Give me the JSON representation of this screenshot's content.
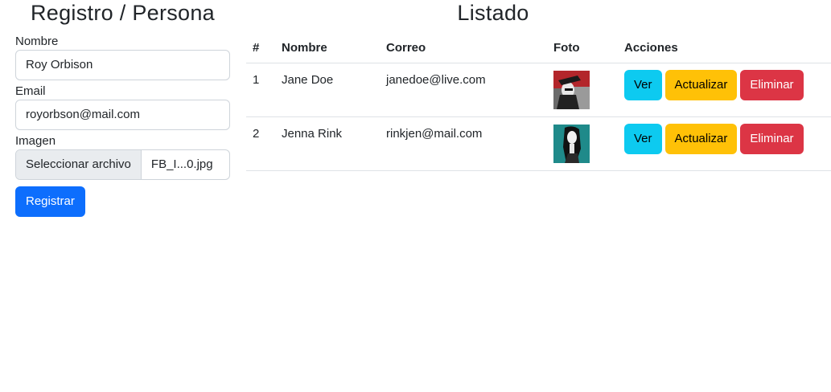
{
  "form": {
    "title": "Registro / Persona",
    "name_label": "Nombre",
    "name_value": "Roy Orbison",
    "email_label": "Email",
    "email_value": "royorbson@mail.com",
    "image_label": "Imagen",
    "file_button_label": "Seleccionar archivo",
    "file_name": "FB_I...0.jpg",
    "submit_label": "Registrar"
  },
  "list": {
    "title": "Listado",
    "columns": [
      "#",
      "Nombre",
      "Correo",
      "Foto",
      "Acciones"
    ],
    "rows": [
      {
        "id": "1",
        "name": "Jane Doe",
        "email": "janedoe@live.com",
        "photo_icon": "photo-thumbnail"
      },
      {
        "id": "2",
        "name": "Jenna Rink",
        "email": "rinkjen@mail.com",
        "photo_icon": "photo-thumbnail"
      }
    ],
    "actions": {
      "view_label": "Ver",
      "update_label": "Actualizar",
      "delete_label": "Eliminar"
    }
  },
  "colors": {
    "primary": "#0d6efd",
    "info": "#0dcaf0",
    "warning": "#ffc107",
    "danger": "#dc3545"
  }
}
